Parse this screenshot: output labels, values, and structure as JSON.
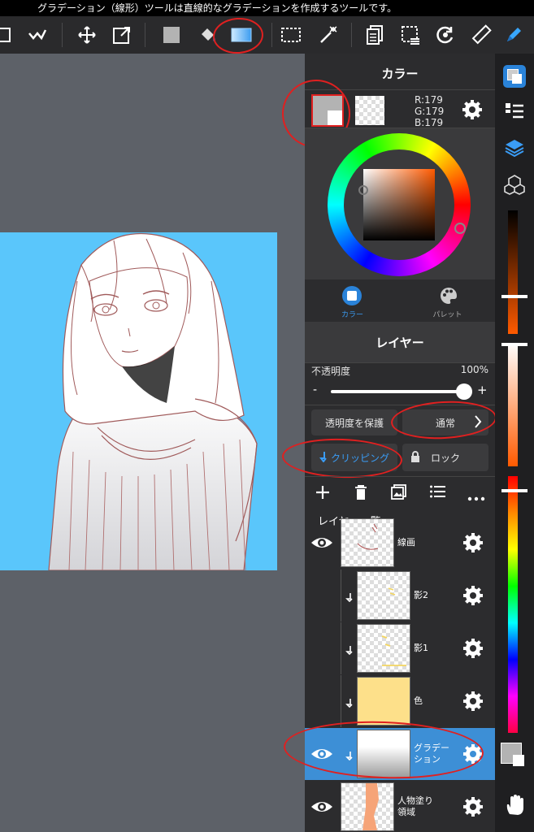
{
  "hint_text": "グラデーション（線形）ツールは直線的なグラデーションを作成するツールです。",
  "color_panel": {
    "title": "カラー",
    "rgb": {
      "r": "R:179",
      "g": "G:179",
      "b": "B:179"
    },
    "tabs": [
      {
        "label": "カラー",
        "active": true
      },
      {
        "label": "パレット",
        "active": false
      }
    ],
    "current_color": "#b3b3b3"
  },
  "layer_panel": {
    "title": "レイヤー",
    "opacity_label": "不透明度",
    "opacity_value": "100%",
    "opacity_fraction": 1.0,
    "minus": "-",
    "plus": "+",
    "protect_alpha": "透明度を保護",
    "blend_mode": "通常",
    "clipping": "クリッピング",
    "lock": "ロック",
    "list_title": "レイヤー一覧",
    "layers": [
      {
        "name": "線画",
        "visible": true,
        "clipped": false,
        "selected": false
      },
      {
        "name": "影2",
        "visible": false,
        "clipped": true,
        "selected": false
      },
      {
        "name": "影1",
        "visible": false,
        "clipped": true,
        "selected": false
      },
      {
        "name": "色",
        "visible": false,
        "clipped": true,
        "selected": false
      },
      {
        "name": "グラデーション",
        "line1": "グラデー",
        "line2": "ション",
        "visible": true,
        "clipped": true,
        "selected": true
      },
      {
        "name": "人物塗り領域",
        "line1": "人物塗り",
        "line2": "領域",
        "visible": true,
        "clipped": false,
        "selected": false
      }
    ]
  },
  "colors": {
    "accent": "#1e90ff",
    "selected_layer": "#3d8fd6",
    "canvas_bg": "#5ac6fb",
    "annotation": "#e02020"
  }
}
